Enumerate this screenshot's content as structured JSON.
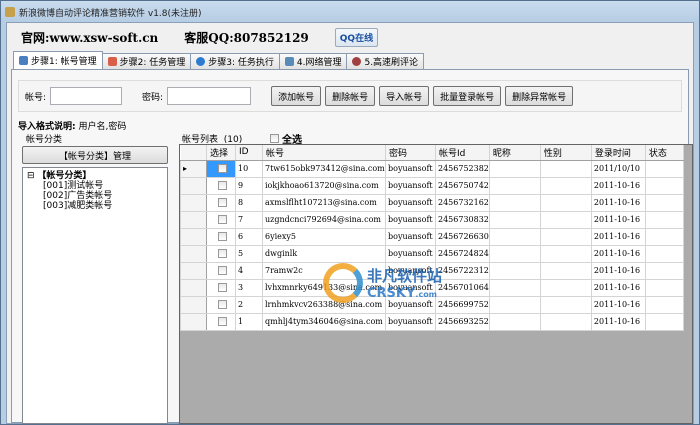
{
  "window": {
    "title": "新浪微博自动评论精准营销软件 v1.8(未注册)"
  },
  "header": {
    "website": "官网:www.xsw-soft.cn",
    "support": "客服QQ:807852129",
    "qq_button": "QQ在线"
  },
  "tabs": [
    {
      "label": "步骤1: 帐号管理",
      "active": true
    },
    {
      "label": "步骤2: 任务管理"
    },
    {
      "label": "步骤3: 任务执行"
    },
    {
      "label": "4.网络管理"
    },
    {
      "label": "5.高速刷评论"
    }
  ],
  "form": {
    "account_label": "帐号:",
    "account_value": "",
    "password_label": "密码:",
    "password_value": "",
    "buttons": [
      "添加帐号",
      "删除帐号",
      "导入帐号",
      "批量登录帐号",
      "删除异常帐号"
    ]
  },
  "import_note": {
    "label": "导入格式说明:",
    "text": "用户名,密码"
  },
  "category": {
    "title": "帐号分类",
    "manage_button": "【帐号分类】管理",
    "root": "【帐号分类】",
    "items": [
      "[001]测试帐号",
      "[002]广告类帐号",
      "[003]减肥类帐号"
    ]
  },
  "list": {
    "title": "帐号列表",
    "count": "(10)",
    "select_all": "全选",
    "columns": [
      "选择",
      "ID",
      "帐号",
      "密码",
      "帐号Id",
      "昵称",
      "性别",
      "登录时间",
      "状态"
    ],
    "rows": [
      [
        "10",
        "7tw615obk973412@sina.com",
        "boyuansoft",
        "2456752382",
        "",
        "",
        "2011/10/10",
        ""
      ],
      [
        "9",
        "iokjkhoao613720@sina.com",
        "boyuansoft",
        "2456750742",
        "",
        "",
        "2011-10-16",
        ""
      ],
      [
        "8",
        "axmslflht107213@sina.com",
        "boyuansoft",
        "2456732162",
        "",
        "",
        "2011-10-16",
        ""
      ],
      [
        "7",
        "uzgndcnci792694@sina.com",
        "boyuansoft",
        "2456730832",
        "",
        "",
        "2011-10-16",
        ""
      ],
      [
        "6",
        "6yiexy5",
        "boyuansoft",
        "2456726630",
        "",
        "",
        "2011-10-16",
        ""
      ],
      [
        "5",
        "dwginlk",
        "boyuansoft",
        "2456724824",
        "",
        "",
        "2011-10-16",
        ""
      ],
      [
        "4",
        "7ramw2c",
        "boyuansoft",
        "2456722312",
        "",
        "",
        "2011-10-16",
        ""
      ],
      [
        "3",
        "lvhxmnrky649133@sina.com",
        "boyuansoft",
        "2456701064",
        "",
        "",
        "2011-10-16",
        ""
      ],
      [
        "2",
        "lrnhmkvcv263388@sina.com",
        "boyuansoft",
        "2456699752",
        "",
        "",
        "2011-10-16",
        ""
      ],
      [
        "1",
        "qmhlj4tym346046@sina.com",
        "boyuansoft",
        "2456693252",
        "",
        "",
        "2011-10-16",
        ""
      ]
    ]
  },
  "watermark": {
    "cn": "非凡软件站",
    "en": "CRSKY",
    "suffix": ".com"
  }
}
